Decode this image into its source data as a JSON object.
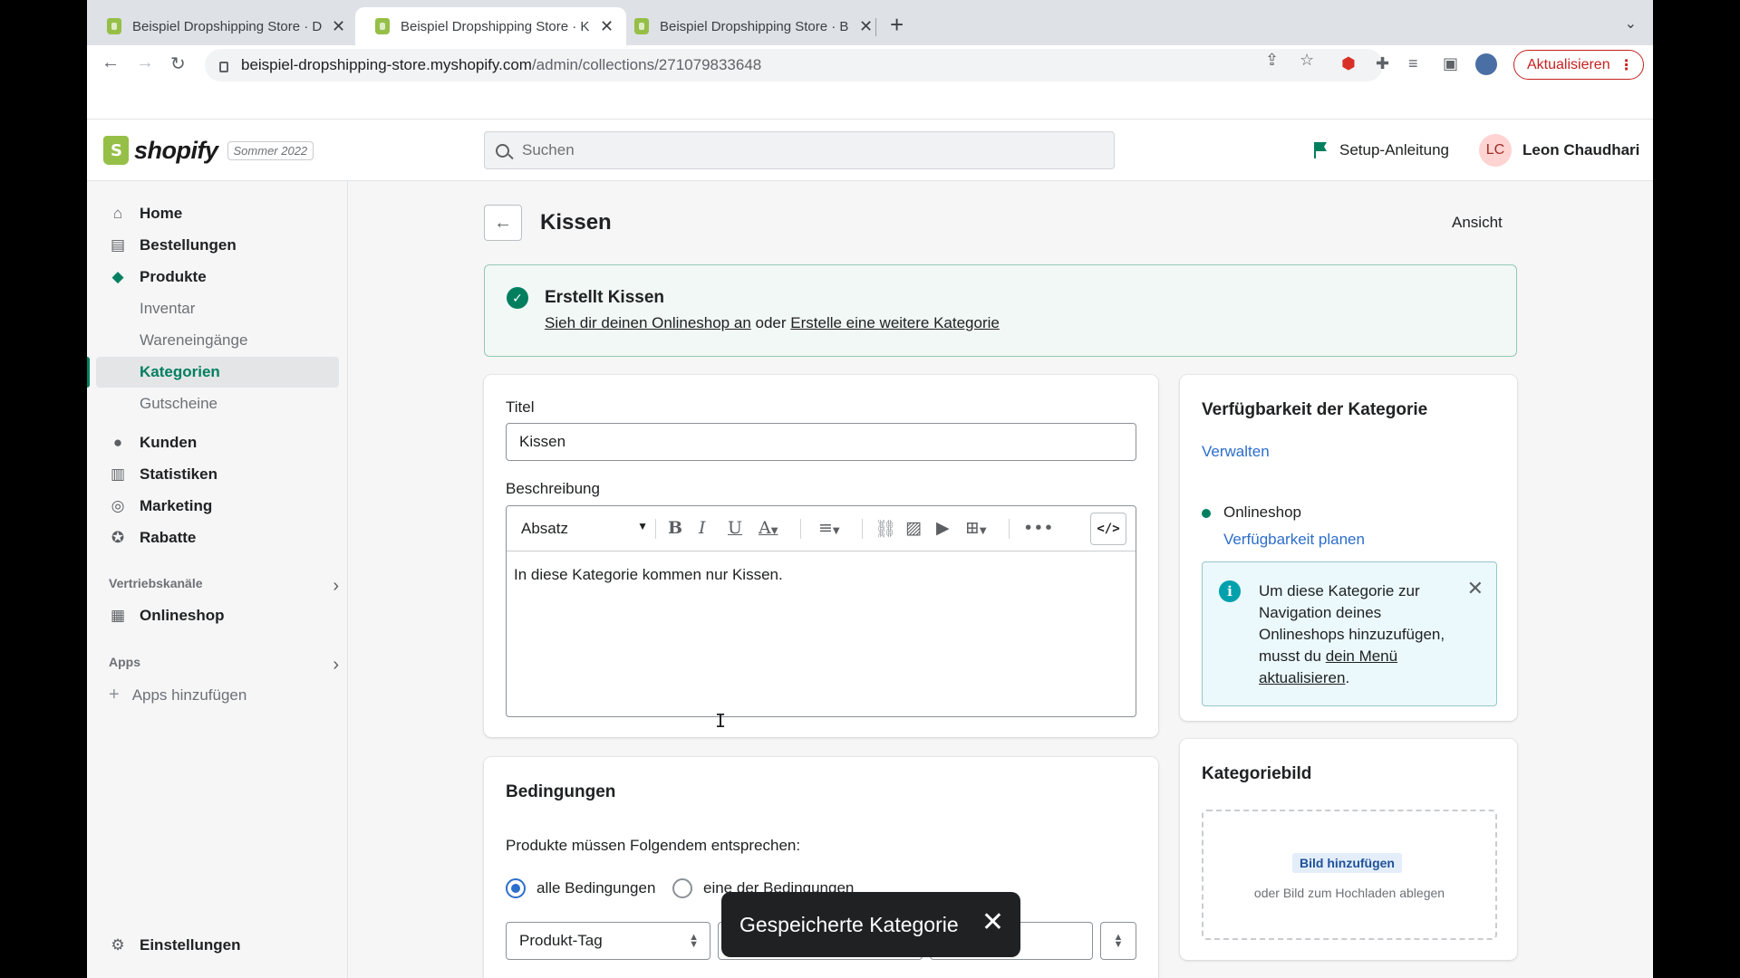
{
  "browser": {
    "tabs": [
      {
        "title": "Beispiel Dropshipping Store · D"
      },
      {
        "title": "Beispiel Dropshipping Store · K"
      },
      {
        "title": "Beispiel Dropshipping Store · B"
      }
    ],
    "url_host": "beispiel-dropshipping-store.myshopify.com",
    "url_path": "/admin/collections/271079833648",
    "update_label": "Aktualisieren"
  },
  "topbar": {
    "logo_text": "shopify",
    "badge": "Sommer 2022",
    "search_placeholder": "Suchen",
    "setup_label": "Setup-Anleitung",
    "avatar_initials": "LC",
    "user_name": "Leon Chaudhari"
  },
  "sidebar": {
    "items": [
      {
        "label": "Home"
      },
      {
        "label": "Bestellungen"
      },
      {
        "label": "Produkte"
      }
    ],
    "sub_items": [
      {
        "label": "Inventar"
      },
      {
        "label": "Wareneingänge"
      },
      {
        "label": "Kategorien"
      },
      {
        "label": "Gutscheine"
      }
    ],
    "items2": [
      {
        "label": "Kunden"
      },
      {
        "label": "Statistiken"
      },
      {
        "label": "Marketing"
      },
      {
        "label": "Rabatte"
      }
    ],
    "channels_heading": "Vertriebskanäle",
    "onlineshop": "Onlineshop",
    "apps_heading": "Apps",
    "apps_add": "Apps hinzufügen",
    "settings": "Einstellungen"
  },
  "page": {
    "title": "Kissen",
    "view_label": "Ansicht"
  },
  "banner": {
    "title": "Erstellt Kissen",
    "link1": "Sieh dir deinen Onlineshop an",
    "middle": " oder ",
    "link2": "Erstelle eine weitere Kategorie"
  },
  "form": {
    "title_label": "Titel",
    "title_value": "Kissen",
    "description_label": "Beschreibung",
    "format_select": "Absatz",
    "description_text": "In diese Kategorie kommen nur Kissen."
  },
  "conditions": {
    "heading": "Bedingungen",
    "subtext": "Produkte müssen Folgendem entsprechen:",
    "option_all": "alle Bedingungen",
    "option_any": "eine der Bedingungen",
    "selected": "alle Bedingungen",
    "field_select": "Produkt-Tag"
  },
  "availability": {
    "heading": "Verfügbarkeit der Kategorie",
    "manage": "Verwalten",
    "channel": "Onlineshop",
    "plan": "Verfügbarkeit planen",
    "info_text": "Um diese Kategorie zur Navigation deines Onlineshops hinzuzufügen, musst du ",
    "info_link": "dein Menü aktualisieren",
    "info_end": "."
  },
  "image_card": {
    "heading": "Kategoriebild",
    "add_button": "Bild hinzufügen",
    "hint": "oder Bild zum Hochladen ablegen"
  },
  "toast": {
    "message": "Gespeicherte Kategorie"
  },
  "colors": {
    "accent": "#008060",
    "link": "#2c6ecb",
    "success_bg": "#f1f8f5",
    "info_bg": "#ebf9fc"
  }
}
